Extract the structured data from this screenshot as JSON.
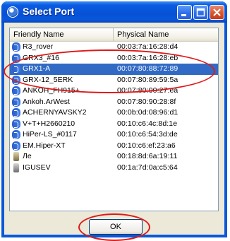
{
  "window": {
    "title": "Select Port"
  },
  "list": {
    "columns": [
      "Friendly Name",
      "Physical Name"
    ],
    "selected_index": 2,
    "rows": [
      {
        "name": "R3_rover",
        "address": "00:03:7a:16:28:d4",
        "icon": "bluetooth-device-icon"
      },
      {
        "name": "GRX3_#16",
        "address": "00:03:7a:16:28:eb",
        "icon": "bluetooth-device-icon"
      },
      {
        "name": "GRX1-A",
        "address": "00:07:80:88:72:89",
        "icon": "bluetooth-device-icon"
      },
      {
        "name": "GRX-12_5ERK",
        "address": "00:07:80:89:59:5a",
        "icon": "bluetooth-device-icon"
      },
      {
        "name": "ANKOH_FH915+",
        "address": "00:07:80:90:27:ea",
        "icon": "bluetooth-device-icon"
      },
      {
        "name": "Ankoh.ArWest",
        "address": "00:07:80:90:28:8f",
        "icon": "bluetooth-device-icon"
      },
      {
        "name": "ACHERNYAVSKY2",
        "address": "00:0b:0d:08:96:d1",
        "icon": "bluetooth-device-icon"
      },
      {
        "name": "V+T+H2660210",
        "address": "00:10:c6:4c:8d:1e",
        "icon": "bluetooth-device-icon"
      },
      {
        "name": "HiPer-LS_#0117",
        "address": "00:10:c6:54:3d:de",
        "icon": "bluetooth-device-icon"
      },
      {
        "name": "EM.Hiper-XT",
        "address": "00:10:c6:ef:23:a6",
        "icon": "bluetooth-device-icon"
      },
      {
        "name": "Ле",
        "address": "00:18:8d:6a:19:11",
        "icon": "phone-icon"
      },
      {
        "name": "IGUSEV",
        "address": "00:1a:7d:0a:c5:64",
        "icon": "phone-icon"
      }
    ]
  },
  "buttons": {
    "ok_label": "OK"
  },
  "colors": {
    "selection": "#316ac5",
    "annotation": "#e01818",
    "titlebar": "#0a5be0"
  }
}
